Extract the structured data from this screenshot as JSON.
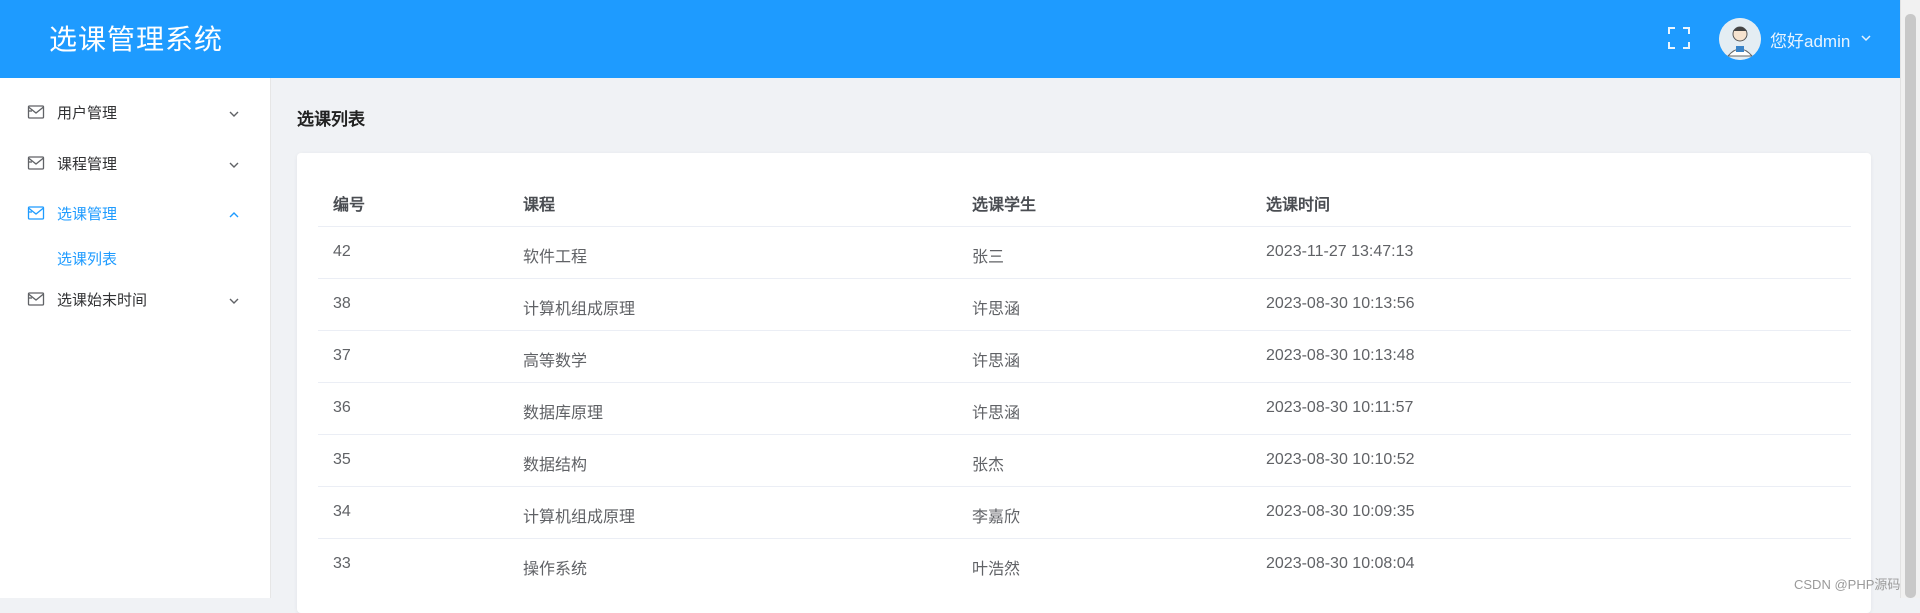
{
  "header": {
    "app_title": "选课管理系统",
    "greeting": "您好admin"
  },
  "sidebar": {
    "items": [
      {
        "label": "用户管理",
        "expanded": false
      },
      {
        "label": "课程管理",
        "expanded": false
      },
      {
        "label": "选课管理",
        "expanded": true,
        "active": true
      },
      {
        "label": "选课始末时间",
        "expanded": false
      }
    ],
    "subitems": [
      {
        "label": "选课列表",
        "active": true
      }
    ]
  },
  "main": {
    "page_title": "选课列表",
    "table": {
      "headers": [
        "编号",
        "课程",
        "选课学生",
        "选课时间"
      ],
      "rows": [
        [
          "42",
          "软件工程",
          "张三",
          "2023-11-27 13:47:13"
        ],
        [
          "38",
          "计算机组成原理",
          "许思涵",
          "2023-08-30 10:13:56"
        ],
        [
          "37",
          "高等数学",
          "许思涵",
          "2023-08-30 10:13:48"
        ],
        [
          "36",
          "数据库原理",
          "许思涵",
          "2023-08-30 10:11:57"
        ],
        [
          "35",
          "数据结构",
          "张杰",
          "2023-08-30 10:10:52"
        ],
        [
          "34",
          "计算机组成原理",
          "李嘉欣",
          "2023-08-30 10:09:35"
        ],
        [
          "33",
          "操作系统",
          "叶浩然",
          "2023-08-30 10:08:04"
        ]
      ]
    }
  },
  "watermark": "CSDN @PHP源码",
  "colors": {
    "header_bg": "#1e9bff",
    "accent": "#1e9bff",
    "sidebar_bg": "#ffffff",
    "content_bg": "#f0f2f5"
  },
  "icons": {
    "fullscreen": "fullscreen-icon",
    "menu": "mail-icon",
    "caret_down": "chevron-down-icon",
    "caret_up": "chevron-up-icon"
  }
}
